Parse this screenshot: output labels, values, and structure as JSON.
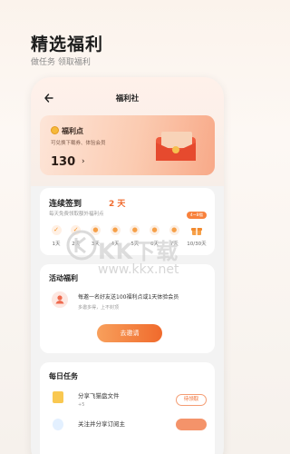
{
  "hero": {
    "title": "精选福利",
    "subtitle": "做任务 领取福利"
  },
  "nav": {
    "back_icon": "arrow-left-icon",
    "title": "福利社"
  },
  "points_card": {
    "label": "福利点",
    "description": "可兑换下载券、体验会员",
    "value": "130",
    "arrow": "›"
  },
  "checkin": {
    "title": "连续签到",
    "days_count": "2 天",
    "subtitle": "每天免费领取额外福利点",
    "gift_badge": "4~8福",
    "days": [
      {
        "label": "1天",
        "status": "done",
        "mark": "✓"
      },
      {
        "label": "2天",
        "status": "done",
        "mark": "✓"
      },
      {
        "label": "3天",
        "status": "todo",
        "mark": "●"
      },
      {
        "label": "4天",
        "status": "todo",
        "mark": "●"
      },
      {
        "label": "5天",
        "status": "todo",
        "mark": "●"
      },
      {
        "label": "6天",
        "status": "todo",
        "mark": "●"
      },
      {
        "label": "7天",
        "status": "todo",
        "mark": "●"
      }
    ],
    "gift_label": "10/30天"
  },
  "activity": {
    "title": "活动福利",
    "text": "每邀一名好友送100福利点或1天体验会员",
    "subtext": "多邀多得，上不封顶",
    "button": "去邀请"
  },
  "daily": {
    "title": "每日任务",
    "tasks": [
      {
        "name": "分享飞猫盘文件",
        "reward": "+5",
        "button": "待领取"
      },
      {
        "name": "关注并分享订阅主",
        "reward": "",
        "button": ""
      }
    ]
  },
  "watermark": {
    "text": "KK下载",
    "url": "www.kkx.net"
  },
  "colors": {
    "accent": "#f06a2c",
    "card_gradient_start": "#fde5d8",
    "card_gradient_end": "#f8a988"
  }
}
